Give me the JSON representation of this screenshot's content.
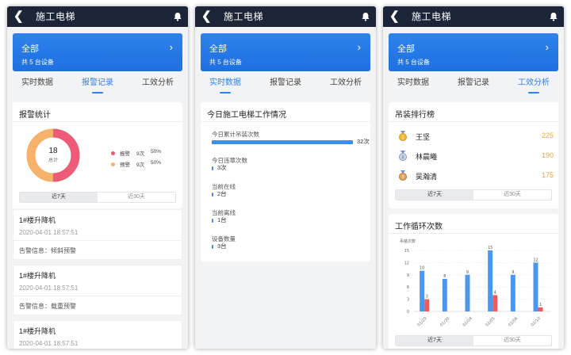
{
  "common": {
    "nav_title": "施工电梯",
    "banner_title": "全部",
    "banner_sub": "共 5 台设备",
    "tabs": [
      "实时数据",
      "报警记录",
      "工效分析"
    ],
    "range": [
      "近7天",
      "近30天"
    ],
    "colors": {
      "navbar": "#1c2638",
      "accent": "#2f7ff0",
      "alarm": "#ee5b78",
      "warning": "#f6b26b",
      "bar_blue": "#4b97f0",
      "bar_red": "#ef5b5b",
      "rank_value": "#e8a43c"
    },
    "icons": {
      "back": "chevron-left-icon",
      "notify": "bell-icon",
      "banner": "chevron-right-icon"
    }
  },
  "alarm_page": {
    "active_tab": 1,
    "stats_title": "报警统计",
    "donut_total": "18",
    "donut_label": "总计",
    "legend": [
      {
        "name": "报警",
        "count": "9次",
        "pct": "50%",
        "color": "#ee5b78"
      },
      {
        "name": "预警",
        "count": "9次",
        "pct": "50%",
        "color": "#f6b26b"
      }
    ],
    "records": [
      {
        "name": "1#楼升降机",
        "time": "2020-04-01 18:57:51",
        "info": "告警信息：倾斜预警"
      },
      {
        "name": "1#楼升降机",
        "time": "2020-04-01 18:57:51",
        "info": "告警信息：载重预警"
      },
      {
        "name": "1#楼升降机",
        "time": "2020-04-01 18:57:51",
        "info": ""
      }
    ]
  },
  "realtime_page": {
    "active_tab": 0,
    "card_title": "今日施工电梯工作情况",
    "stats": [
      {
        "label": "今日累计吊装次数",
        "value": "32次",
        "fill": 1.0
      },
      {
        "label": "今日违章次数",
        "value": "3次",
        "fill": 0.01
      },
      {
        "label": "当前在线",
        "value": "2台",
        "fill": 0.01
      },
      {
        "label": "当前离线",
        "value": "1台",
        "fill": 0.01
      },
      {
        "label": "设备数量",
        "value": "3台",
        "fill": 0.01
      }
    ]
  },
  "analysis_page": {
    "active_tab": 2,
    "rank_title": "吊装排行榜",
    "ranks": [
      {
        "name": "王坚",
        "value": "225",
        "medal": "gold-medal-icon"
      },
      {
        "name": "林晨曦",
        "value": "190",
        "medal": "silver-medal-icon"
      },
      {
        "name": "吴瀚清",
        "value": "175",
        "medal": "bronze-medal-icon"
      }
    ],
    "cycle_title": "工作循环次数",
    "chart_data": {
      "type": "bar",
      "ylabel": "吊装次数",
      "ylim": [
        0,
        15
      ],
      "yticks": [
        0,
        3,
        6,
        9,
        12,
        15
      ],
      "categories": [
        "01/29",
        "01/30",
        "02/04",
        "02/05",
        "02/06",
        "02/10"
      ],
      "series": [
        {
          "values": [
            10,
            8,
            9,
            15,
            9,
            12
          ],
          "color": "#4b97f0"
        },
        {
          "values": [
            3,
            0,
            0,
            4,
            0,
            1
          ],
          "color": "#ef5b5b"
        }
      ],
      "grid": true
    }
  }
}
